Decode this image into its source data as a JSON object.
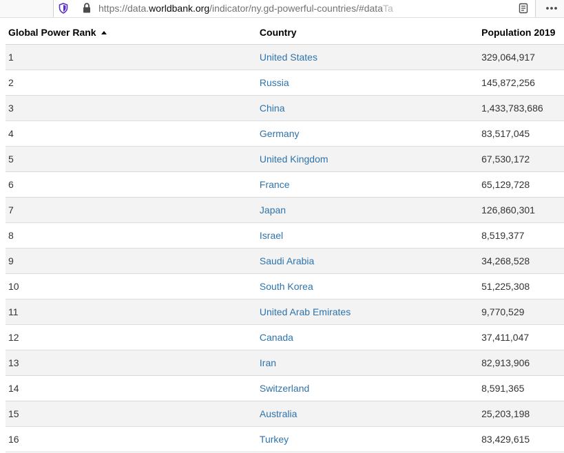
{
  "browser": {
    "url_prefix": "https://data.",
    "url_domain": "worldbank.org",
    "url_path": "/indicator/ny.gd-powerful-countries/#data",
    "url_fade": "Ta",
    "icons": [
      "shield-icon",
      "lock-icon",
      "reader-view-icon",
      "more-icon"
    ]
  },
  "table": {
    "headers": {
      "rank": "Global Power Rank",
      "country": "Country",
      "population": "Population 2019"
    },
    "sort": {
      "column": "rank",
      "direction": "ascending"
    },
    "rows": [
      {
        "rank": "1",
        "country": "United States",
        "population": "329,064,917"
      },
      {
        "rank": "2",
        "country": "Russia",
        "population": "145,872,256"
      },
      {
        "rank": "3",
        "country": "China",
        "population": "1,433,783,686"
      },
      {
        "rank": "4",
        "country": "Germany",
        "population": "83,517,045"
      },
      {
        "rank": "5",
        "country": "United Kingdom",
        "population": "67,530,172"
      },
      {
        "rank": "6",
        "country": "France",
        "population": "65,129,728"
      },
      {
        "rank": "7",
        "country": "Japan",
        "population": "126,860,301"
      },
      {
        "rank": "8",
        "country": "Israel",
        "population": "8,519,377"
      },
      {
        "rank": "9",
        "country": "Saudi Arabia",
        "population": "34,268,528"
      },
      {
        "rank": "10",
        "country": "South Korea",
        "population": "51,225,308"
      },
      {
        "rank": "11",
        "country": "United Arab Emirates",
        "population": "9,770,529"
      },
      {
        "rank": "12",
        "country": "Canada",
        "population": "37,411,047"
      },
      {
        "rank": "13",
        "country": "Iran",
        "population": "82,913,906"
      },
      {
        "rank": "14",
        "country": "Switzerland",
        "population": "8,591,365"
      },
      {
        "rank": "15",
        "country": "Australia",
        "population": "25,203,198"
      },
      {
        "rank": "16",
        "country": "Turkey",
        "population": "83,429,615"
      }
    ]
  },
  "colors": {
    "link": "#2e73ab",
    "stripe": "#f3f3f3",
    "text": "#333333"
  }
}
